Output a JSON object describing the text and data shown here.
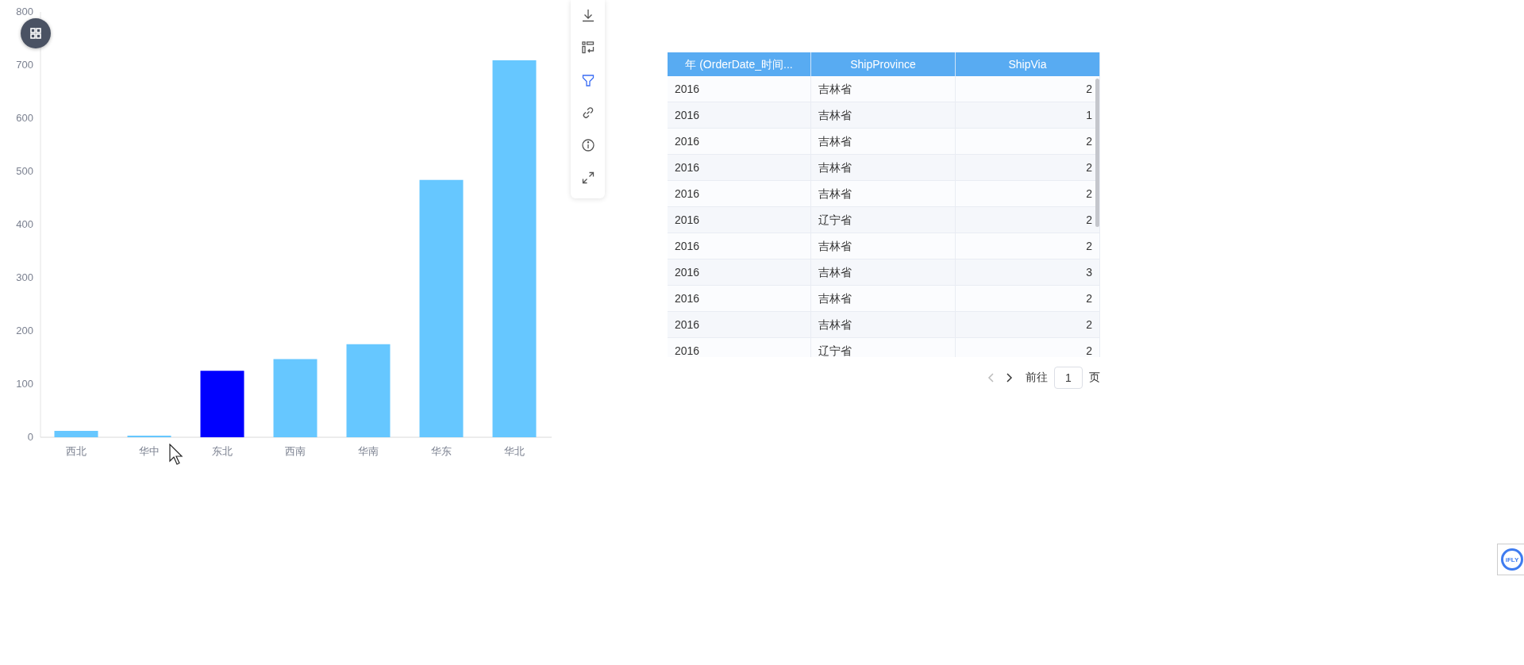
{
  "chart": {
    "chart_data": {
      "type": "bar",
      "categories": [
        "西北",
        "华中",
        "东北",
        "西南",
        "华南",
        "华东",
        "华北"
      ],
      "series": [
        {
          "color": "#66c7ff",
          "values": [
            12,
            3,
            null,
            147,
            175,
            484,
            709
          ]
        },
        {
          "color": "#0000ff",
          "values": [
            null,
            null,
            125,
            null,
            null,
            null,
            null
          ]
        }
      ],
      "ylim": [
        0,
        800
      ],
      "yticks": [
        0,
        100,
        200,
        300,
        400,
        500,
        600,
        700,
        800
      ]
    }
  },
  "toolbar": {
    "items": [
      {
        "kind": "download",
        "active": false
      },
      {
        "kind": "swap",
        "active": false
      },
      {
        "kind": "filter",
        "active": true
      },
      {
        "kind": "link",
        "active": false
      },
      {
        "kind": "info",
        "active": false
      },
      {
        "kind": "expand",
        "active": false
      }
    ]
  },
  "table": {
    "columns": [
      "年 (OrderDate_时间...",
      "ShipProvince",
      "ShipVia"
    ],
    "rows": [
      [
        "2016",
        "吉林省",
        "2"
      ],
      [
        "2016",
        "吉林省",
        "1"
      ],
      [
        "2016",
        "吉林省",
        "2"
      ],
      [
        "2016",
        "吉林省",
        "2"
      ],
      [
        "2016",
        "吉林省",
        "2"
      ],
      [
        "2016",
        "辽宁省",
        "2"
      ],
      [
        "2016",
        "吉林省",
        "2"
      ],
      [
        "2016",
        "吉林省",
        "3"
      ],
      [
        "2016",
        "吉林省",
        "2"
      ],
      [
        "2016",
        "吉林省",
        "2"
      ],
      [
        "2016",
        "辽宁省",
        "2"
      ]
    ]
  },
  "pagination": {
    "prev": {
      "disabled": true
    },
    "next": {
      "disabled": false
    },
    "goto_label": "前往",
    "page": "1",
    "page_suffix": "页"
  },
  "assistant_badge": {
    "label": "iFLY"
  }
}
